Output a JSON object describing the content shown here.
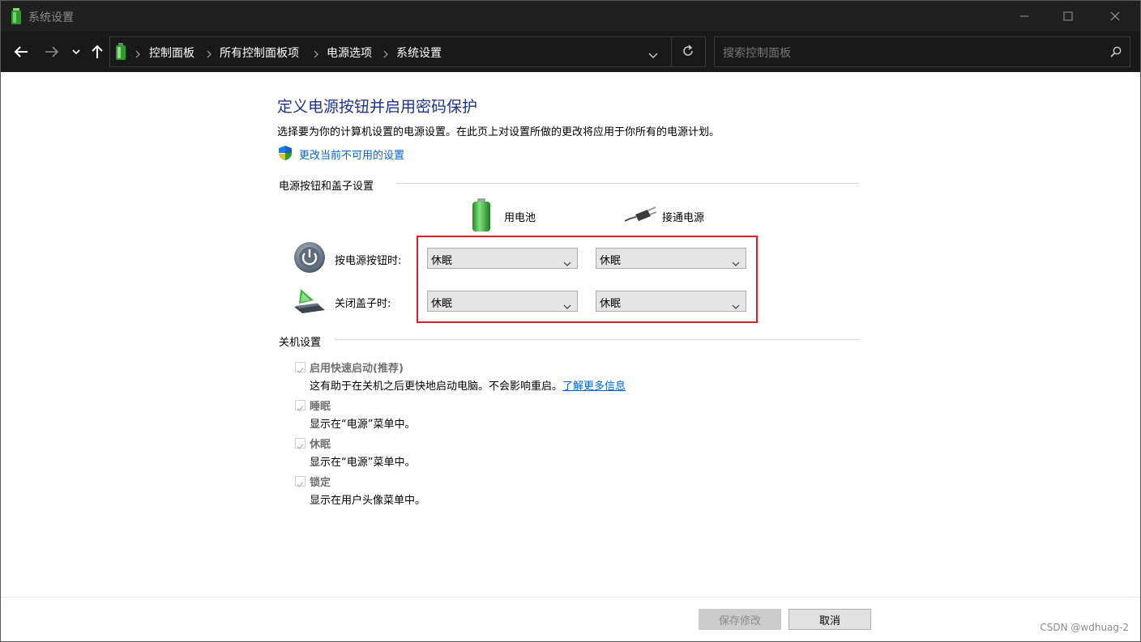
{
  "window": {
    "title": "系统设置",
    "controls": [
      "minimize-icon",
      "maximize-icon",
      "close-icon"
    ]
  },
  "nav": {
    "breadcrumb": [
      "控制面板",
      "所有控制面板项",
      "电源选项",
      "系统设置"
    ],
    "search_placeholder": "搜索控制面板"
  },
  "content": {
    "heading": "定义电源按钮并启用密码保护",
    "description": "选择要为你的计算机设置的电源设置。在此页上对设置所做的更改将应用于你所有的电源计划。",
    "change_link": "更改当前不可用的设置",
    "power_section": {
      "title": "电源按钮和盖子设置",
      "col_battery": "用电池",
      "col_plugged": "接通电源",
      "rows": [
        {
          "label": "按电源按钮时:",
          "battery": "休眠",
          "plugged": "休眠"
        },
        {
          "label": "关闭盖子时:",
          "battery": "休眠",
          "plugged": "休眠"
        }
      ]
    },
    "shutdown_section": {
      "title": "关机设置",
      "items": [
        {
          "label": "启用快速启动(推荐)",
          "desc": "这有助于在关机之后更快地启动电脑。不会影响重启。",
          "link": "了解更多信息",
          "checked": true
        },
        {
          "label": "睡眠",
          "desc": "显示在“电源”菜单中。",
          "checked": true
        },
        {
          "label": "休眠",
          "desc": "显示在“电源”菜单中。",
          "checked": true
        },
        {
          "label": "锁定",
          "desc": "显示在用户头像菜单中。",
          "checked": true
        }
      ]
    }
  },
  "footer": {
    "save_label": "保存修改",
    "cancel_label": "取消"
  },
  "watermark": "CSDN @wdhuag-2",
  "colors": {
    "heading": "#1e3287",
    "link": "#0066cc",
    "highlight_box": "#d9202a",
    "titlebar": "#202020"
  }
}
